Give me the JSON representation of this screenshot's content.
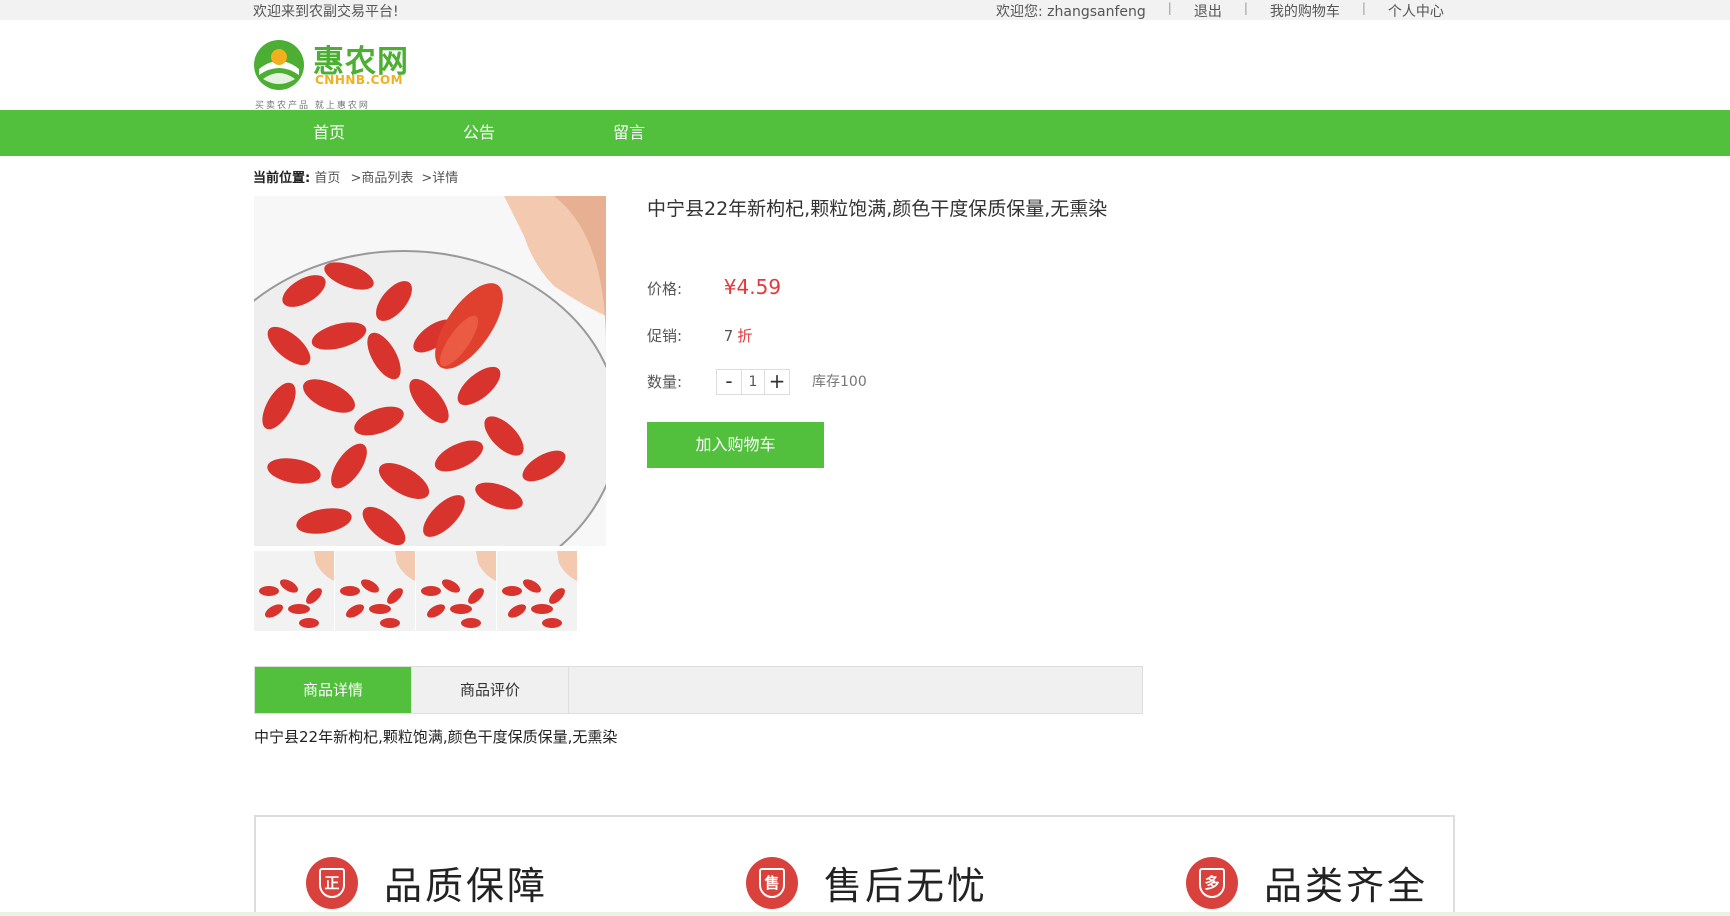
{
  "topbar": {
    "welcome": "欢迎来到农副交易平台!",
    "user_greeting": "欢迎您: zhangsanfeng",
    "logout": "退出",
    "cart": "我的购物车",
    "profile": "个人中心",
    "separator": "|"
  },
  "logo": {
    "name": "惠农网",
    "domain": "CNHNB.COM",
    "slogan": "买卖农产品  就上惠农网",
    "colors": {
      "green": "#4cae33",
      "yellow": "#f2b01e"
    }
  },
  "nav": {
    "items": [
      {
        "label": "首页"
      },
      {
        "label": "公告"
      },
      {
        "label": "留言"
      }
    ],
    "color": "#52bf3d"
  },
  "breadcrumb": {
    "label": "当前位置:",
    "home": "首页",
    "list": ">商品列表",
    "detail": ">详情"
  },
  "product": {
    "title": "中宁县22年新枸杞,颗粒饱满,颜色干度保质保量,无熏染",
    "price_label": "价格:",
    "price": "¥4.59",
    "promo_label": "促销:",
    "discount_value": "7",
    "discount_unit": "折",
    "qty_label": "数量:",
    "qty_minus": "-",
    "qty_value": "1",
    "qty_plus": "+",
    "stock": "库存100",
    "add_to_cart": "加入购物车",
    "image": "goji-berries-photo",
    "thumbnail_count": 4
  },
  "tabs": {
    "items": [
      {
        "label": "商品详情",
        "active": true
      },
      {
        "label": "商品评价",
        "active": false
      }
    ]
  },
  "description": "中宁县22年新枸杞,颗粒饱满,颜色干度保质保量,无熏染",
  "guarantees": [
    {
      "icon": "正",
      "text": "品质保障"
    },
    {
      "icon": "售",
      "text": "售后无忧"
    },
    {
      "icon": "多",
      "text": "品类齐全"
    }
  ],
  "colors": {
    "accent_green": "#52bf3d",
    "price_red": "#e4393c",
    "guarantee_red": "#d9413c"
  }
}
